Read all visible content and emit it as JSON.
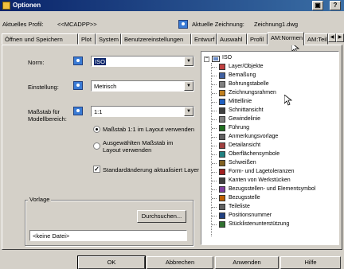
{
  "window": {
    "title": "Optionen",
    "help_btn": "?",
    "restore_btn": "▣"
  },
  "profile": {
    "label": "Aktuelles Profil:",
    "value": "<<MCADPP>>",
    "drawing_label": "Aktuelle Zeichnung:",
    "drawing_value": "Zeichnung1.dwg"
  },
  "tabs": [
    "Öffnen und Speichern",
    "Plot",
    "System",
    "Benutzereinstellungen",
    "Entwurf",
    "Auswahl",
    "Profil",
    "AM:Normen",
    "AM:Teil"
  ],
  "active_tab": "AM:Normen",
  "form": {
    "norm_label": "Norm:",
    "norm_value": "ISO",
    "einstellung_label": "Einstellung:",
    "einstellung_value": "Metrisch",
    "massstab_label": "Maßstab für Modellbereich:",
    "massstab_value": "1:1",
    "radio1": "Maßstab 1:1 im Layout verwenden",
    "radio2": "Ausgewählten Maßstab im Layout verwenden",
    "checkbox": "Standardänderung aktualisiert Layer"
  },
  "vorlage": {
    "title": "Vorlage",
    "browse_btn": "Durchsuchen...",
    "file_value": "<keine Datei>"
  },
  "tree": {
    "root": "ISO",
    "items": [
      "Layer/Objekte",
      "Bemaßung",
      "Bohrungstabelle",
      "Zeichnungsrahmen",
      "Mittellinie",
      "Schnittansicht",
      "Gewindelinie",
      "Führung",
      "Anmerkungsvorlage",
      "Detailansicht",
      "Oberflächensymbole",
      "Schweißen",
      "Form- und Lagetoleranzen",
      "Kanten von Werkstücken",
      "Bezugsstellen- und Elementsymbol",
      "Bezugsstelle",
      "Teileliste",
      "Positionsnummer",
      "Stücklistenunterstützung"
    ]
  },
  "buttons": {
    "ok": "OK",
    "cancel": "Abbrechen",
    "apply": "Anwenden",
    "help": "Hilfe"
  },
  "colors": {
    "title_bar": "#0a246a",
    "face": "#d4d0c8",
    "selection": "#0a246a"
  }
}
